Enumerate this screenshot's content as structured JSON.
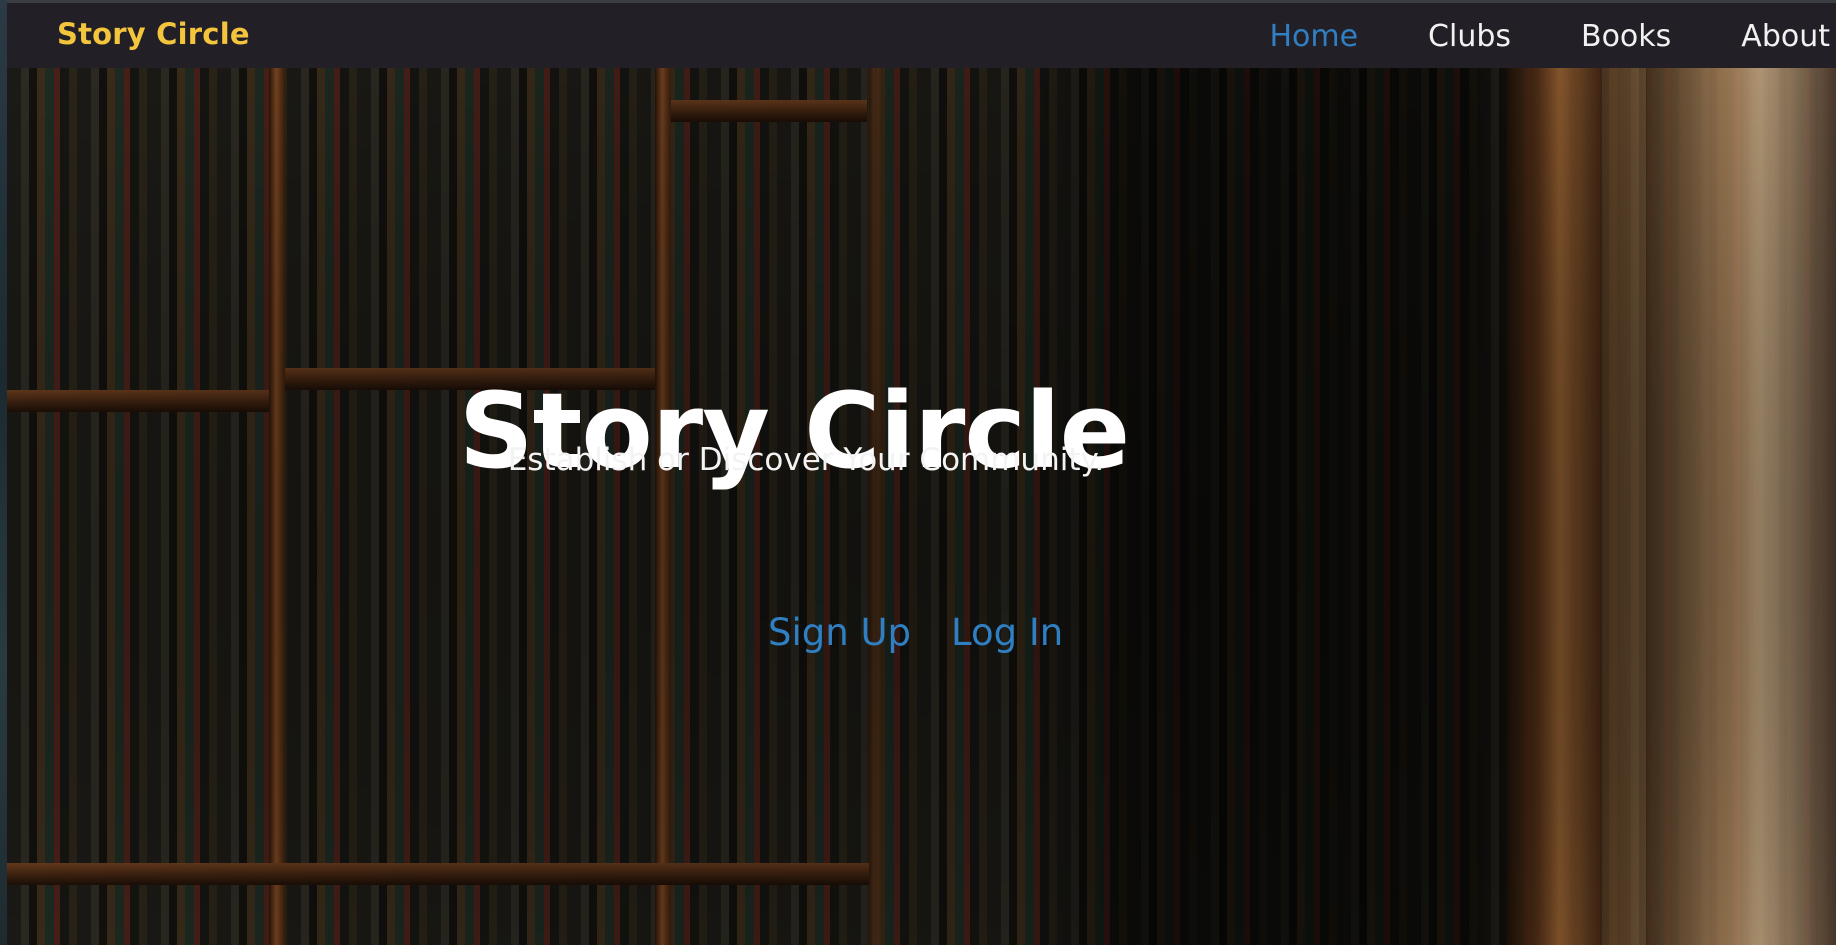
{
  "navbar": {
    "brand": "Story Circle",
    "links": [
      {
        "label": "Home",
        "active": true
      },
      {
        "label": "Clubs",
        "active": false
      },
      {
        "label": "Books",
        "active": false
      },
      {
        "label": "About",
        "active": false
      }
    ]
  },
  "hero": {
    "title": "Story Circle",
    "subtitle": "Establish or Discover Your Community.",
    "actions": {
      "signup_label": "Sign Up",
      "login_label": "Log In"
    },
    "background_image": "bookshelf photo"
  },
  "colors": {
    "brand": "#f3c53d",
    "link_active": "#2f7fc2",
    "navbar_bg": "#221f26",
    "text": "#ffffff"
  }
}
